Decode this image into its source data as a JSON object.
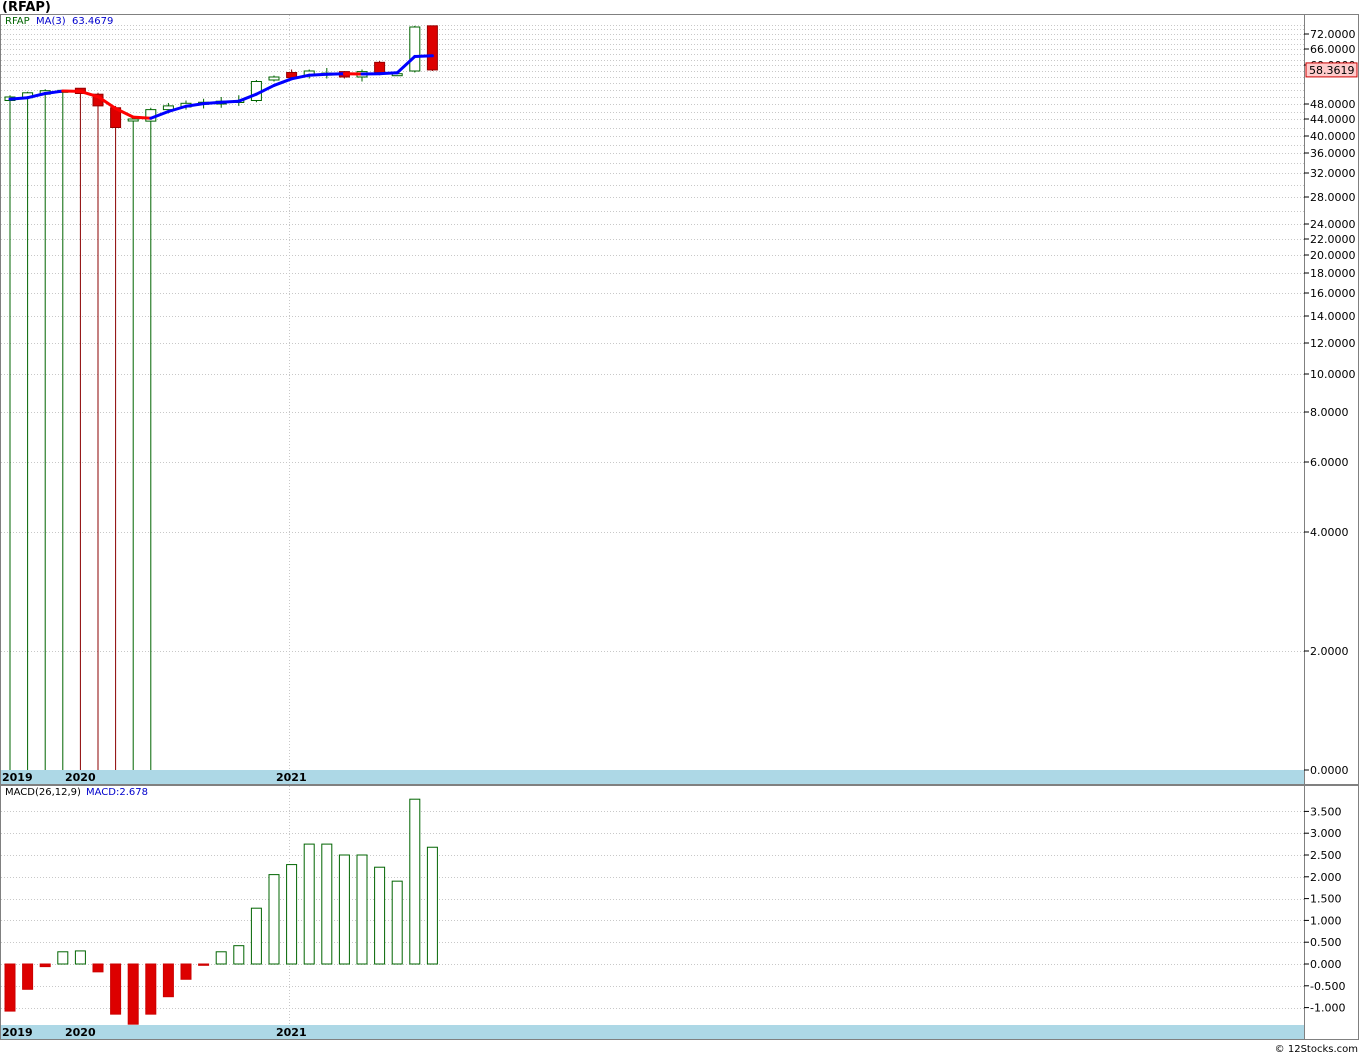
{
  "title": "(RFAP)",
  "footer": "© 12Stocks.com",
  "colors": {
    "up": "#006400",
    "down": "#dd0000",
    "downWick": "#8b0000",
    "maUp": "#0000ff",
    "maDown": "#ff0000",
    "axisBand": "#add8e6",
    "grid": "#bbbbbb",
    "lastPriceBg": "#ffcccc"
  },
  "price_panel": {
    "legend": {
      "symbol": "RFAP",
      "ma_label": "MA(3)",
      "ma_value": "63.4679"
    },
    "last_price": "58.3619",
    "y_ticks": [
      "72.0000",
      "66.0000",
      "60.0000",
      "48.0000",
      "44.0000",
      "40.0000",
      "36.0000",
      "32.0000",
      "28.0000",
      "24.0000",
      "22.0000",
      "20.0000",
      "18.0000",
      "16.0000",
      "14.0000",
      "12.0000",
      "10.0000",
      "8.0000",
      "6.0000",
      "4.0000",
      "2.0000",
      "0.0000"
    ],
    "year_labels": [
      "2019",
      "2020",
      "2021"
    ]
  },
  "macd_panel": {
    "legend": {
      "label": "MACD(26,12,9)",
      "value_label": "MACD:2.678"
    },
    "y_ticks": [
      "3.500",
      "3.000",
      "2.500",
      "2.000",
      "1.500",
      "1.000",
      "0.500",
      "0.000",
      "-0.500",
      "-1.000"
    ],
    "year_labels": [
      "2019",
      "2020",
      "2021"
    ]
  },
  "chart_data": [
    {
      "type": "candlestick",
      "title": "(RFAP)",
      "scale": "log",
      "ylim": [
        0,
        78
      ],
      "series": [
        {
          "name": "RFAP",
          "candles": [
            {
              "o": 49.0,
              "c": 50.0,
              "h": 50.5,
              "l": 0
            },
            {
              "o": 49.8,
              "c": 51.2,
              "h": 51.5,
              "l": 0
            },
            {
              "o": 50.8,
              "c": 51.8,
              "h": 52.2,
              "l": 0
            },
            {
              "o": 51.7,
              "c": 51.9,
              "h": 52.0,
              "l": 0
            },
            {
              "o": 52.5,
              "c": 51.0,
              "h": 52.5,
              "l": 0
            },
            {
              "o": 50.8,
              "c": 47.5,
              "h": 51.2,
              "l": 0
            },
            {
              "o": 47.0,
              "c": 42.0,
              "h": 47.5,
              "l": 0
            },
            {
              "o": 44.0,
              "c": 44.0,
              "h": 44.5,
              "l": 0
            },
            {
              "o": 43.5,
              "c": 46.5,
              "h": 47.0,
              "l": 0
            },
            {
              "o": 46.5,
              "c": 47.5,
              "h": 48.3,
              "l": 45.5
            },
            {
              "o": 47.2,
              "c": 48.2,
              "h": 49.0,
              "l": 46.5
            },
            {
              "o": 48.0,
              "c": 48.5,
              "h": 49.5,
              "l": 46.8
            },
            {
              "o": 48.0,
              "c": 48.8,
              "h": 50.0,
              "l": 47.0
            },
            {
              "o": 48.5,
              "c": 49.0,
              "h": 50.5,
              "l": 47.5
            },
            {
              "o": 49.0,
              "c": 54.5,
              "h": 55.0,
              "l": 48.5
            },
            {
              "o": 55.0,
              "c": 56.0,
              "h": 56.5,
              "l": 54.5
            },
            {
              "o": 57.5,
              "c": 55.8,
              "h": 58.5,
              "l": 55.5
            },
            {
              "o": 56.5,
              "c": 58.0,
              "h": 58.5,
              "l": 55.5
            },
            {
              "o": 57.0,
              "c": 57.3,
              "h": 59.0,
              "l": 55.5
            },
            {
              "o": 57.8,
              "c": 56.0,
              "h": 58.0,
              "l": 55.5
            },
            {
              "o": 56.0,
              "c": 57.8,
              "h": 58.5,
              "l": 54.5
            },
            {
              "o": 61.0,
              "c": 57.5,
              "h": 61.5,
              "l": 57.0
            },
            {
              "o": 57.0,
              "c": 57.1,
              "h": 57.5,
              "l": 56.5
            },
            {
              "o": 58.0,
              "c": 75.0,
              "h": 75.5,
              "l": 57.5
            },
            {
              "o": 75.5,
              "c": 58.36,
              "h": 75.5,
              "l": 58.0
            }
          ]
        },
        {
          "name": "MA(3)",
          "values": [
            49.4,
            49.8,
            51.0,
            51.7,
            51.6,
            50.1,
            46.8,
            44.5,
            44.2,
            46.0,
            47.4,
            48.1,
            48.5,
            48.8,
            50.8,
            53.3,
            55.4,
            56.6,
            56.9,
            57.1,
            57.0,
            57.1,
            57.4,
            63.2,
            63.4679
          ]
        }
      ]
    },
    {
      "type": "bar",
      "title": "MACD(26,12,9)",
      "ylim": [
        -1.4,
        3.9
      ],
      "series": [
        {
          "name": "MACD",
          "values": [
            -1.08,
            -0.58,
            -0.06,
            0.28,
            0.3,
            -0.18,
            -1.15,
            -1.38,
            -1.15,
            -0.75,
            -0.35,
            -0.03,
            0.28,
            0.42,
            1.28,
            2.05,
            2.28,
            2.75,
            2.75,
            2.5,
            2.5,
            2.22,
            1.9,
            3.78,
            2.678
          ]
        }
      ]
    }
  ]
}
